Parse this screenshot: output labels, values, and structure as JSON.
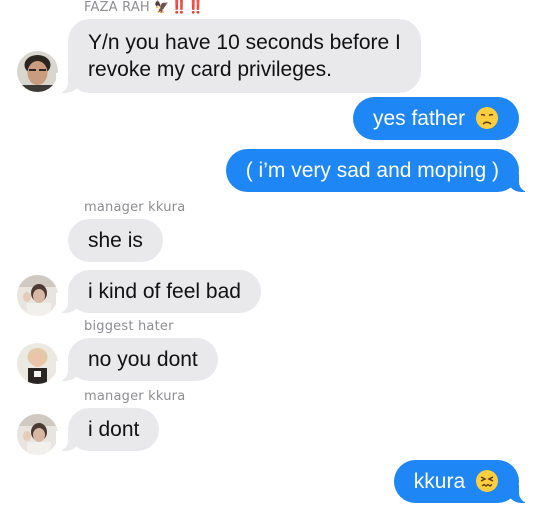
{
  "thread": {
    "messages": [
      {
        "sender": "FAZA RAH",
        "sender_suffix": "‼️‼️",
        "text": "Y/n you have 10 seconds before I",
        "text_line2": "revoke my card privileges."
      },
      {
        "text": "yes father",
        "emoji": "disappointed-face"
      },
      {
        "text": "( i’m very sad and moping )"
      },
      {
        "sender": "manager kkura",
        "text": "she is"
      },
      {
        "text": "i kind of feel bad"
      },
      {
        "sender": "biggest hater",
        "text": "no you dont"
      },
      {
        "sender": "manager kkura",
        "text": "i dont"
      },
      {
        "text": "kkura",
        "emoji": "confounded-face"
      }
    ]
  },
  "icons": {
    "sender_tag": "eagle-icon",
    "emoji_1": "disappointed-face-emoji",
    "emoji_2": "confounded-face-emoji"
  },
  "colors": {
    "outgoing_bubble": "#1f86f5",
    "incoming_bubble": "#e9e9eb",
    "sender_label": "#8e8e93",
    "alert_marks": "#ff2d2d"
  }
}
